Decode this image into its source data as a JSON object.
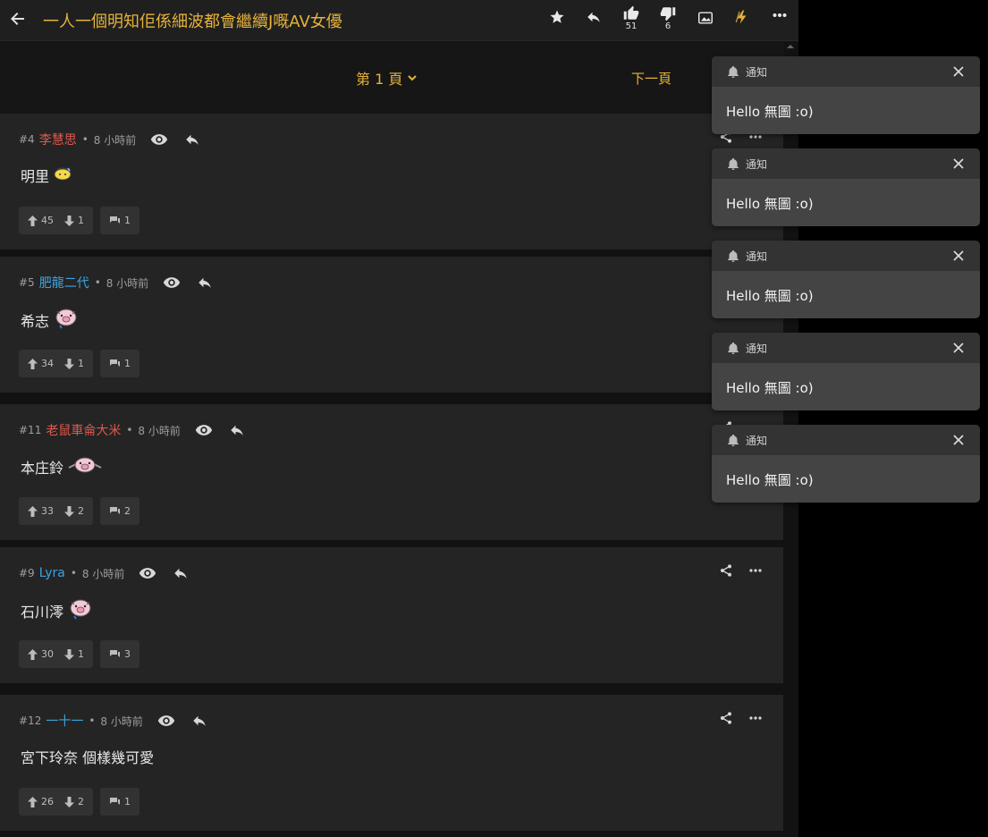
{
  "topbar": {
    "title": "一人一個明知佢係細波都會繼續J嘅AV女優",
    "like_count": "51",
    "dislike_count": "6"
  },
  "pagination": {
    "current_page": "第 1 頁",
    "next_label": "下一頁"
  },
  "posts": [
    {
      "num": "#4",
      "user": "李慧思",
      "user_color": "#e0594b",
      "time": "8 小時前",
      "text": "明里",
      "emoji": "sweat",
      "up": "45",
      "down": "1",
      "comments": "1"
    },
    {
      "num": "#5",
      "user": "肥龍二代",
      "user_color": "#3ea3e0",
      "time": "8 小時前",
      "text": "希志",
      "emoji": "pig",
      "up": "34",
      "down": "1",
      "comments": "1"
    },
    {
      "num": "#11",
      "user": "老鼠車侖大米",
      "user_color": "#e0594b",
      "time": "8 小時前",
      "text": "本庄鈴",
      "emoji": "pig-wide",
      "up": "33",
      "down": "2",
      "comments": "2"
    },
    {
      "num": "#9",
      "user": "Lyra",
      "user_color": "#3ea3e0",
      "time": "8 小時前",
      "text": "石川澪",
      "emoji": "pig",
      "up": "30",
      "down": "1",
      "comments": "3"
    },
    {
      "num": "#12",
      "user": "一十一",
      "user_color": "#3ea3e0",
      "time": "8 小時前",
      "text": "宮下玲奈 個樣幾可愛",
      "emoji": "",
      "up": "26",
      "down": "2",
      "comments": "1"
    }
  ],
  "separator": "•",
  "notifications": [
    {
      "label": "通知",
      "message": "Hello 無圖 :o)"
    },
    {
      "label": "通知",
      "message": "Hello 無圖 :o)"
    },
    {
      "label": "通知",
      "message": "Hello 無圖 :o)"
    },
    {
      "label": "通知",
      "message": "Hello 無圖 :o)"
    },
    {
      "label": "通知",
      "message": "Hello 無圖 :o)"
    }
  ],
  "colors": {
    "accent": "#e6b23a",
    "user_red": "#e0594b",
    "user_blue": "#3ea3e0"
  },
  "icons": [
    "back-arrow-icon",
    "star-icon",
    "reply-icon",
    "thumb-up-icon",
    "thumb-down-icon",
    "image-icon",
    "lightning-icon",
    "more-icon",
    "eye-icon",
    "share-icon",
    "arrow-up-icon",
    "arrow-down-icon",
    "comment-icon",
    "bell-icon",
    "close-icon",
    "chevron-down-icon"
  ]
}
